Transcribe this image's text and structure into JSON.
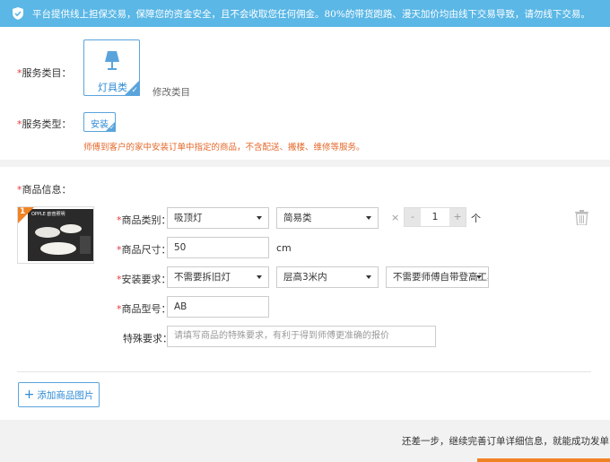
{
  "notice": {
    "text": "平台提供线上担保交易，保障您的资金安全，且不会收取您任何佣金。80%的带货跑路、漫天加价均由线下交易导致，请勿线下交易。",
    "icon": "shield-check-icon"
  },
  "service_category": {
    "label": "服务类目：",
    "selected": "灯具类",
    "icon": "lamp-icon",
    "modify_link": "修改类目"
  },
  "service_type": {
    "label": "服务类型：",
    "selected": "安装",
    "description": "师傅到客户的家中安装订单中指定的商品，不含配送、搬楼、维修等服务。"
  },
  "product_info": {
    "label": "商品信息：",
    "image": {
      "index": "1",
      "brand_text": "OPPLE 欧普照明"
    },
    "fields": {
      "category_label": "商品类别：",
      "category_value": "吸顶灯",
      "subcategory_value": "简易类",
      "times": "×",
      "quantity": "1",
      "quantity_minus": "-",
      "quantity_plus": "+",
      "quantity_unit": "个",
      "size_label": "商品尺寸：",
      "size_value": "50",
      "size_unit": "cm",
      "install_label": "安装要求：",
      "install_opt1": "不需要拆旧灯",
      "install_opt2": "层高3米内",
      "install_opt3": "不需要师傅自带登高工具",
      "model_label": "商品型号：",
      "model_value": "AB",
      "special_label": "特殊要求：",
      "special_placeholder": "请填写商品的特殊要求，有利于得到师傅更准确的报价"
    }
  },
  "add_image_button": "添加商品图片",
  "footer": {
    "text": "还差一步，继续完善订单详细信息，就能成功发单了！"
  },
  "colors": {
    "notice_bg": "#5ab7e6",
    "accent_blue": "#2c8ad6",
    "required_red": "#e4393c",
    "desc_orange": "#e4682a",
    "footer_orange": "#f08324"
  }
}
